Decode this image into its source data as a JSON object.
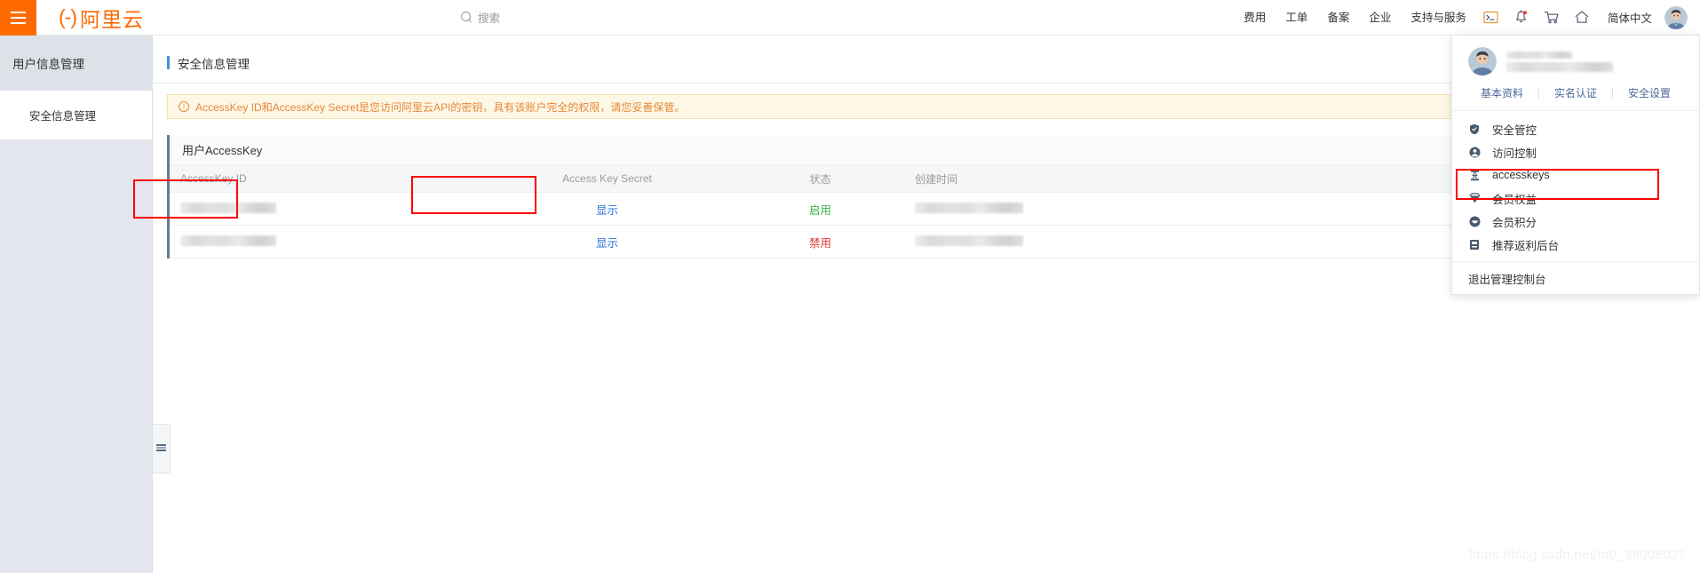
{
  "header": {
    "hamburger": "menu-icon",
    "brand_mark": "(-)",
    "brand_text": "阿里云",
    "search": {
      "placeholder": "搜索",
      "value": "",
      "icon": "search-icon"
    },
    "nav": [
      {
        "label": "费用"
      },
      {
        "label": "工单"
      },
      {
        "label": "备案"
      },
      {
        "label": "企业"
      },
      {
        "label": "支持与服务"
      }
    ],
    "icons": [
      {
        "name": "terminal-icon",
        "badge": false
      },
      {
        "name": "bell-icon",
        "badge": true
      },
      {
        "name": "cart-icon",
        "badge": false
      },
      {
        "name": "home-icon",
        "badge": false
      }
    ],
    "language": "简体中文",
    "avatar": "user-avatar"
  },
  "sidebar": {
    "heading": "用户信息管理",
    "items": [
      {
        "label": "安全信息管理",
        "active": true
      }
    ],
    "collapse_handle": "sidebar-collapse-icon"
  },
  "main": {
    "page_title": "安全信息管理",
    "notice": {
      "icon": "warning-circle-icon",
      "text": "AccessKey ID和AccessKey Secret是您访问阿里云API的密钥，具有该账户完全的权限，请您妥善保管。"
    },
    "panel_title": "用户AccessKey",
    "table": {
      "columns": [
        "AccessKey ID",
        "Access Key Secret",
        "状态",
        "创建时间"
      ],
      "rows": [
        {
          "access_key_id": "",
          "secret_action": "显示",
          "status": "启用",
          "status_type": "enabled",
          "create_time": ""
        },
        {
          "access_key_id": "",
          "secret_action": "显示",
          "status": "禁用",
          "status_type": "disabled",
          "create_time": ""
        }
      ]
    }
  },
  "user_menu": {
    "username": "",
    "account": "",
    "quick_links": [
      {
        "label": "基本资料"
      },
      {
        "label": "实名认证"
      },
      {
        "label": "安全设置"
      }
    ],
    "items": [
      {
        "label": "安全管控",
        "icon": "shield-icon",
        "highlighted": false
      },
      {
        "label": "访问控制",
        "icon": "person-icon",
        "highlighted": false
      },
      {
        "label": "accesskeys",
        "icon": "key-icon",
        "highlighted": true
      },
      {
        "label": "会员权益",
        "icon": "diamond-icon",
        "highlighted": false
      },
      {
        "label": "会员积分",
        "icon": "coin-icon",
        "highlighted": false
      },
      {
        "label": "推荐返利后台",
        "icon": "wallet-icon",
        "highlighted": false
      }
    ],
    "logout": "退出管理控制台"
  },
  "annotations": {
    "boxes": [
      "accesskey-id-column",
      "access-key-secret-column",
      "accesskeys-menu-item"
    ],
    "color": "#ff0000"
  },
  "watermark": "https://blog.csdn.net/m0_38008027",
  "colors": {
    "brand_orange": "#ff6a00",
    "status_enabled": "#38b149",
    "status_disabled": "#e03a3a",
    "link_blue": "#2d6fd4",
    "notice_bg": "#fdf8e6",
    "notice_text": "#e8873a"
  }
}
